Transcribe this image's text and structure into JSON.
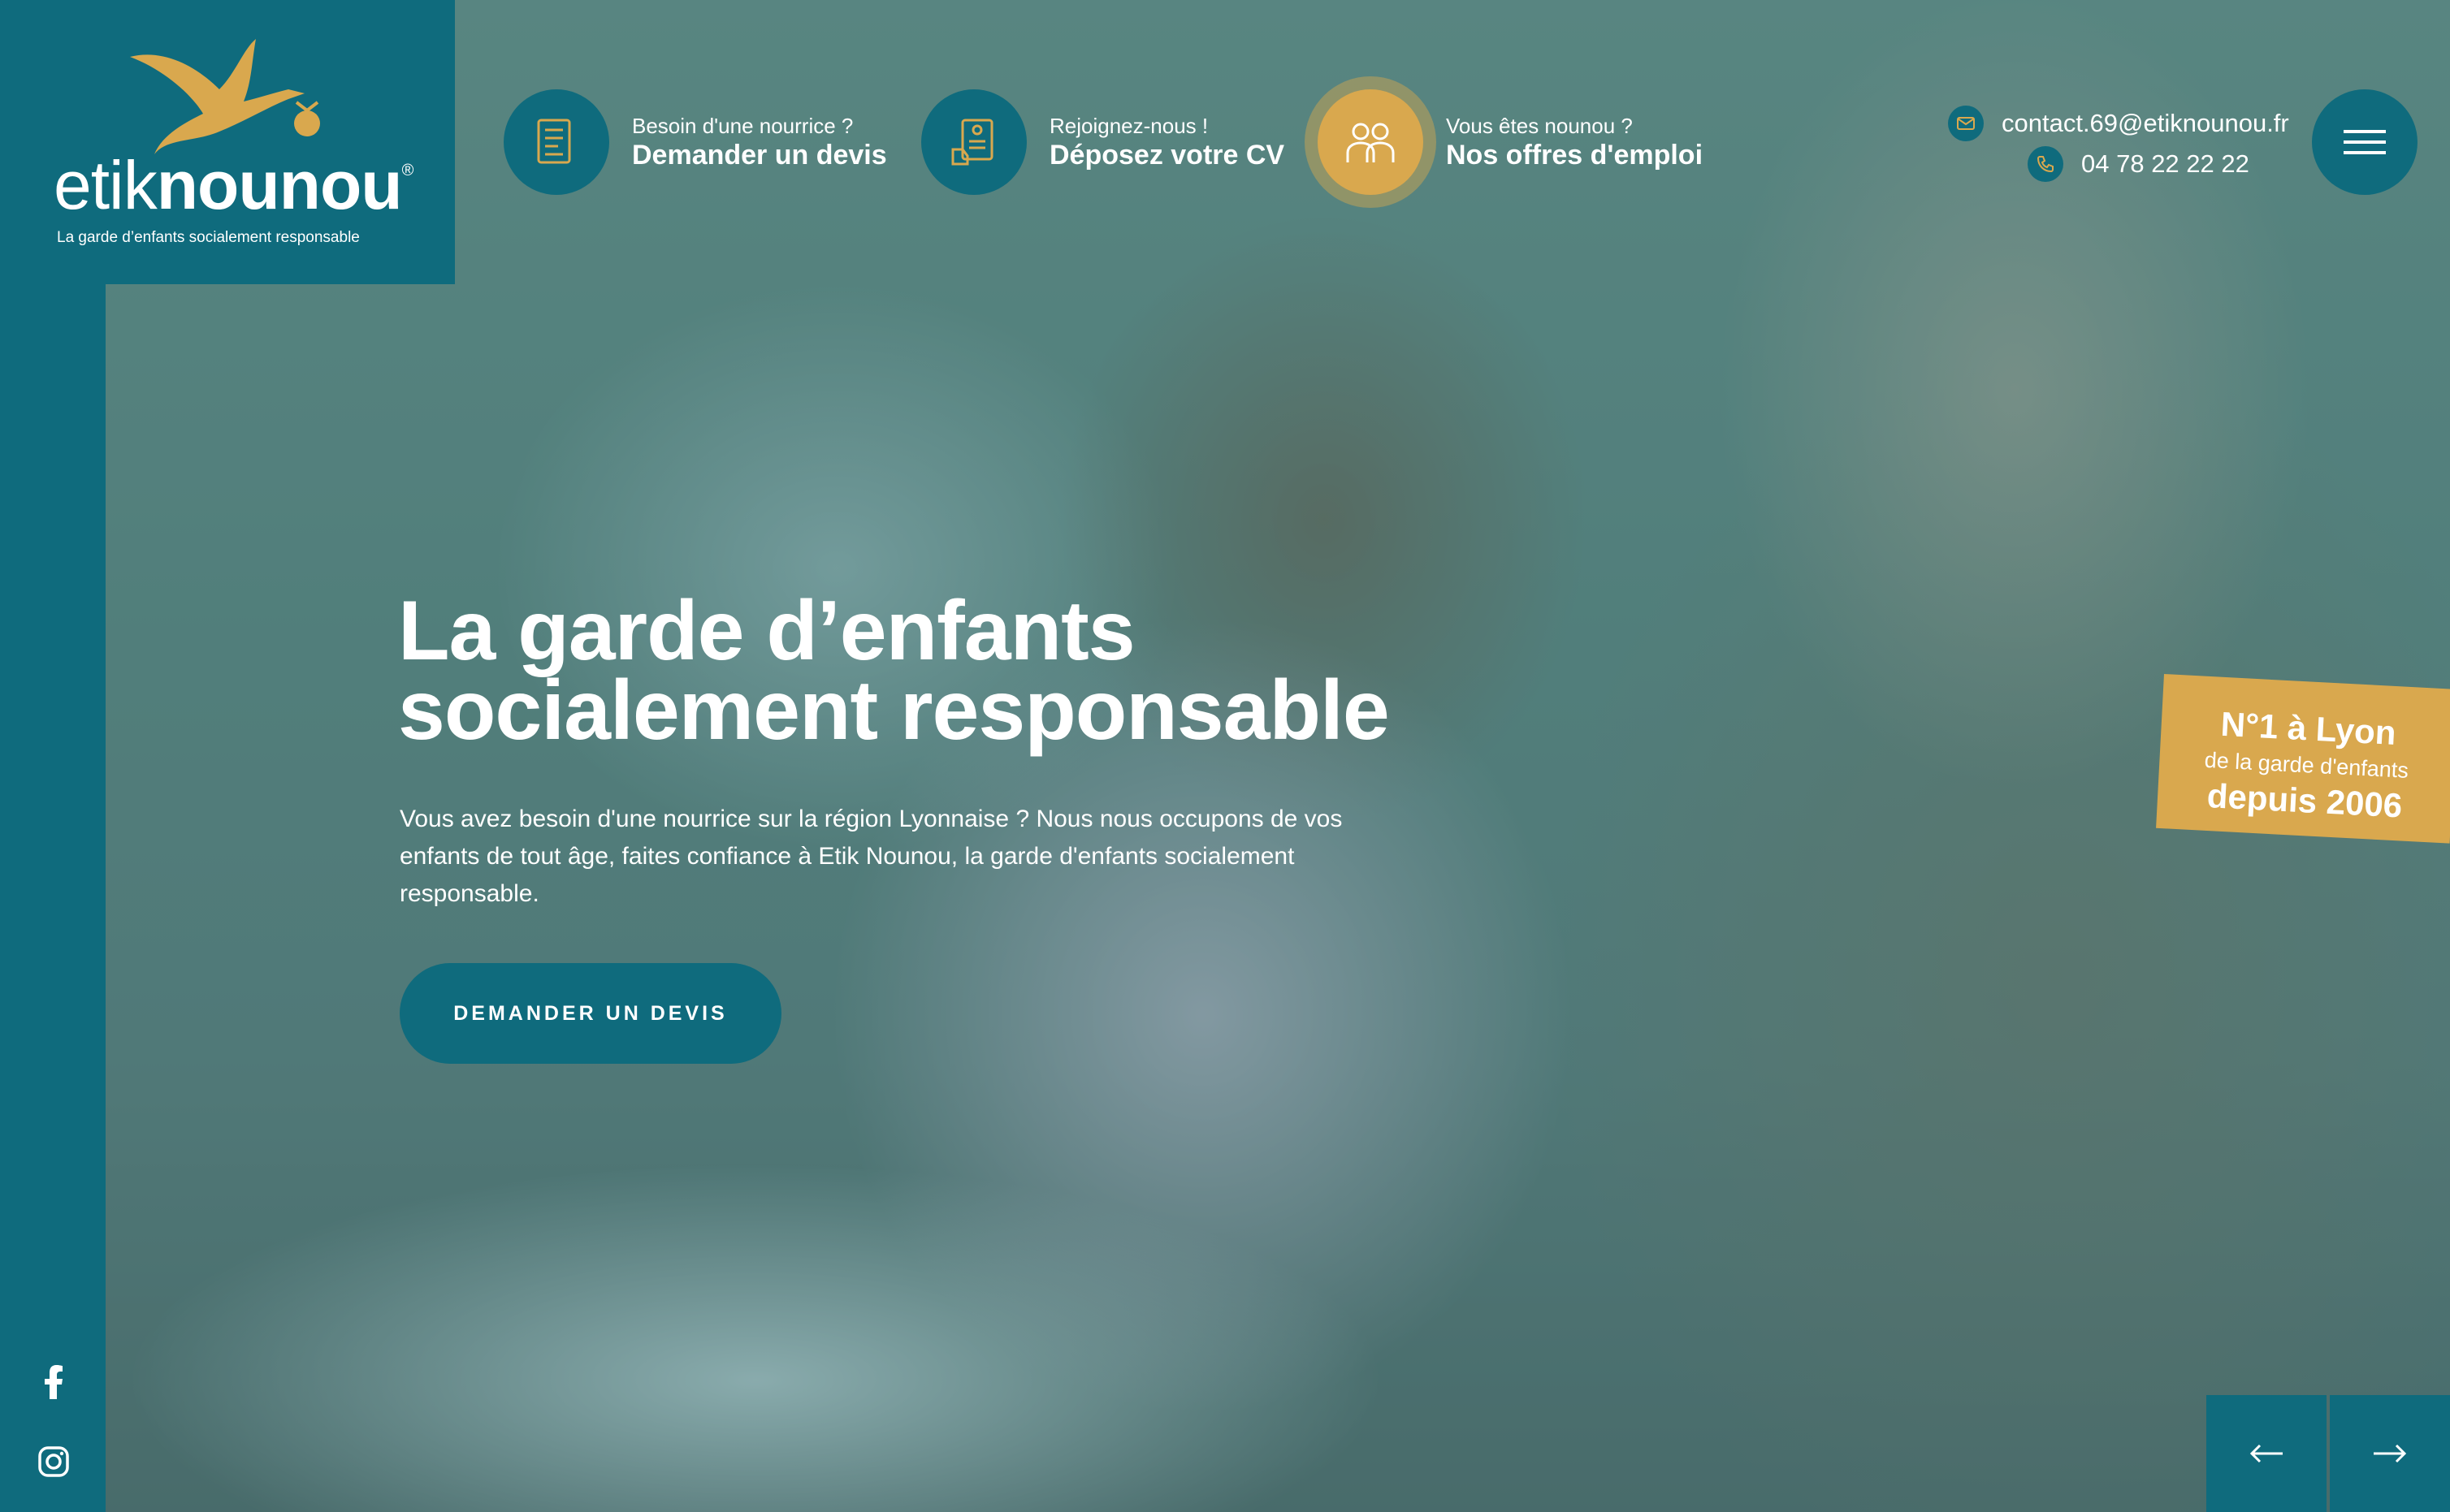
{
  "brand": {
    "name_light": "etik",
    "name_bold": "nounou",
    "registered": "®",
    "tagline": "La garde d’enfants socialement responsable"
  },
  "header": {
    "actions": [
      {
        "small": "Besoin d'une nourrice ?",
        "big": "Demander un devis",
        "icon": "document-quote-icon"
      },
      {
        "small": "Rejoignez-nous !",
        "big": "Déposez votre CV",
        "icon": "cv-icon"
      },
      {
        "small": "Vous êtes nounou ?",
        "big": "Nos offres d'emploi",
        "icon": "people-icon"
      }
    ],
    "email": "contact.69@etiknounou.fr",
    "phone": "04 78 22 22 22",
    "menu_icon": "hamburger-menu-icon"
  },
  "hero": {
    "title_line1": "La garde d’enfants",
    "title_line2": "socialement responsable",
    "intro": "Vous avez besoin d'une nourrice sur la région Lyonnaise ? Nous nous occupons de vos enfants de tout âge, faites confiance à Etik Nounou, la garde d'enfants socialement responsable.",
    "cta": "DEMANDER UN DEVIS"
  },
  "badge": {
    "line1": "N°1 à Lyon",
    "line2": "de la garde d'enfants",
    "line3": "depuis 2006"
  },
  "social": [
    "facebook-icon",
    "instagram-icon"
  ],
  "slider": {
    "prev": "←",
    "next": "→"
  },
  "colors": {
    "teal": "#0f6b7d",
    "gold": "#d9a84e",
    "white": "#ffffff"
  }
}
